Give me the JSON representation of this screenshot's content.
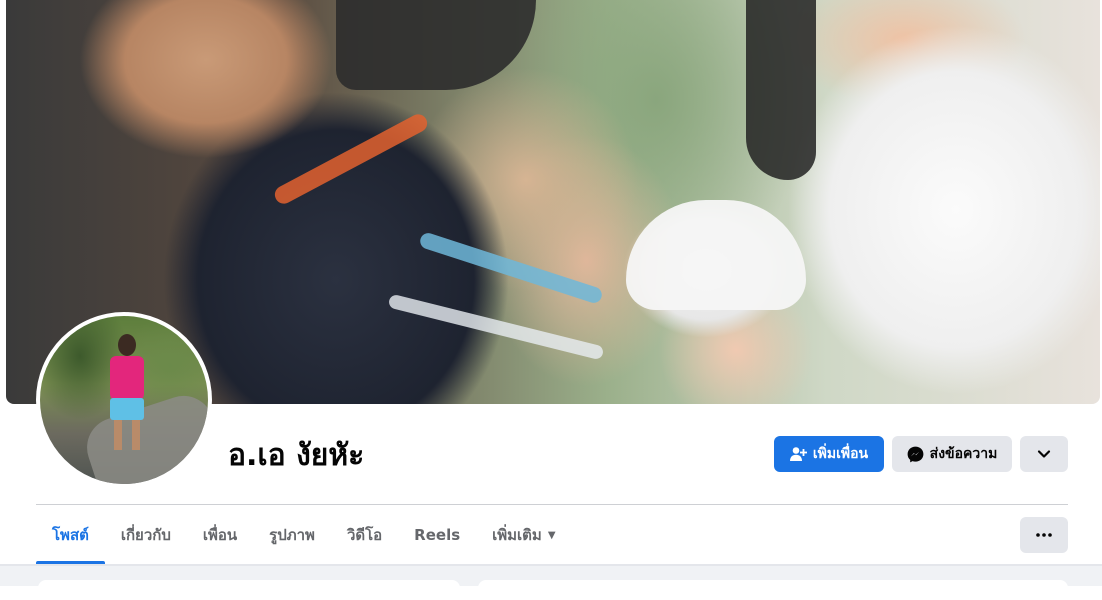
{
  "profile": {
    "name": "อ.เอ งัยหัะ"
  },
  "actions": {
    "add_friend_label": "เพิ่มเพื่อน",
    "add_friend_icon": "person-add-icon",
    "message_label": "ส่งข้อความ",
    "message_icon": "messenger-icon",
    "more_icon": "chevron-down-icon"
  },
  "tabs": [
    {
      "label": "โพสต์",
      "active": true
    },
    {
      "label": "เกี่ยวกับ",
      "active": false
    },
    {
      "label": "เพื่อน",
      "active": false
    },
    {
      "label": "รูปภาพ",
      "active": false
    },
    {
      "label": "วิดีโอ",
      "active": false
    },
    {
      "label": "Reels",
      "active": false
    },
    {
      "label": "เพิ่มเติม",
      "active": false,
      "has_caret": true
    }
  ],
  "tabs_more_icon": "ellipsis-icon",
  "colors": {
    "accent": "#1b74e4",
    "button_gray": "#e4e6eb",
    "text_primary": "#050505",
    "text_secondary": "#65676b",
    "page_bg": "#f0f2f5"
  }
}
